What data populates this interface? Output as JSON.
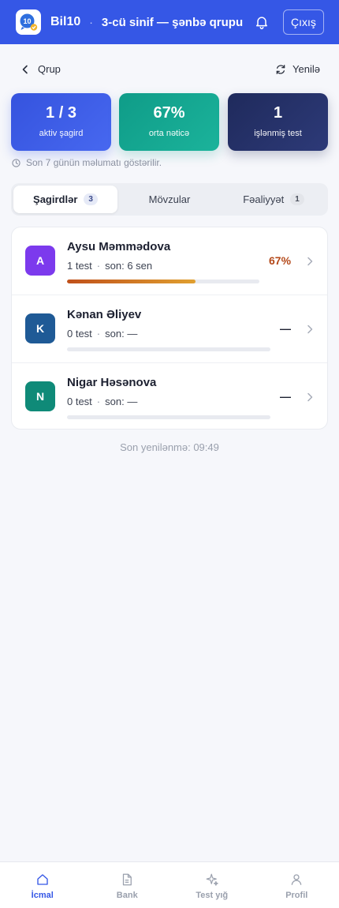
{
  "header": {
    "brand": "Bil10",
    "separator": "·",
    "group_title": "3-cü sinif — şənbə qrupu",
    "logout_label": "Çıxış",
    "logo_text": "10"
  },
  "nav": {
    "back_label": "Qrup",
    "refresh_label": "Yenilə"
  },
  "stats": [
    {
      "value": "1 / 3",
      "label": "aktiv şagird"
    },
    {
      "value": "67%",
      "label": "orta nəticə"
    },
    {
      "value": "1",
      "label": "işlənmiş test"
    }
  ],
  "notice": "Son 7 günün məlumatı göstərilir.",
  "tabs": [
    {
      "label": "Şagirdlər",
      "badge": "3",
      "active": true
    },
    {
      "label": "Mövzular",
      "badge": "",
      "active": false
    },
    {
      "label": "Fəaliyyət",
      "badge": "1",
      "active": false
    }
  ],
  "students": [
    {
      "initial": "A",
      "name": "Aysu Məmmədova",
      "tests": "1 test",
      "last": "son: 6 sen",
      "score": "67%",
      "progress": 0.67,
      "avatar_color": "#7c3aed"
    },
    {
      "initial": "K",
      "name": "Kənan Əliyev",
      "tests": "0 test",
      "last": "son: —",
      "score": "—",
      "progress": 0,
      "avatar_color": "#1f5a96"
    },
    {
      "initial": "N",
      "name": "Nigar Həsənova",
      "tests": "0 test",
      "last": "son: —",
      "score": "—",
      "progress": 0,
      "avatar_color": "#0f8a78"
    }
  ],
  "meta_separator": "·",
  "last_updated": "Son yenilənmə: 09:49",
  "bottom_nav": [
    {
      "label": "İcmal",
      "icon": "home-icon",
      "active": true
    },
    {
      "label": "Bank",
      "icon": "document-icon",
      "active": false
    },
    {
      "label": "Test yığ",
      "icon": "sparkle-icon",
      "active": false
    },
    {
      "label": "Profil",
      "icon": "user-icon",
      "active": false
    }
  ],
  "colors": {
    "header_bg": "#3557e6",
    "accent": "#3557e6",
    "score_color": "#b4491a"
  }
}
